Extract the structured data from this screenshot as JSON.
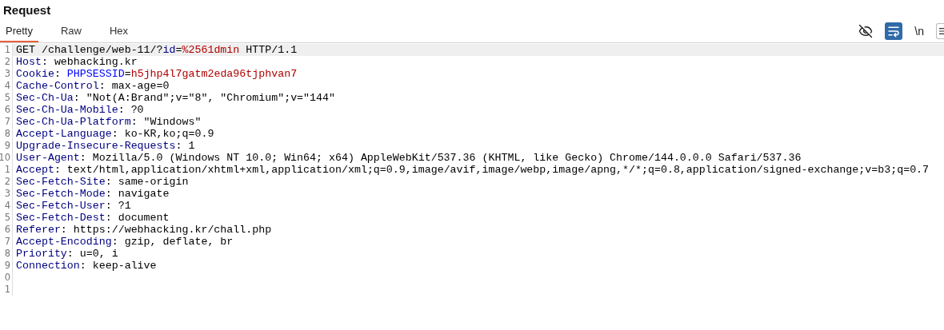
{
  "panel": {
    "title": "Request"
  },
  "tabs": [
    {
      "label": "Pretty",
      "selected": true
    },
    {
      "label": "Raw",
      "selected": false
    },
    {
      "label": "Hex",
      "selected": false
    }
  ],
  "toolbar": {
    "hide_toggle": {
      "on": false
    },
    "wrap_toggle": {
      "on": true
    },
    "newline_toggle": {
      "label": "\\n",
      "on": false
    }
  },
  "editor": {
    "lines": [
      {
        "number": "1",
        "current": true,
        "segments": [
          {
            "kind": "plain",
            "text": "GET /challenge/web-11/?"
          },
          {
            "kind": "name",
            "text": "id"
          },
          {
            "kind": "plain",
            "text": "="
          },
          {
            "kind": "value",
            "text": "%2561dmin"
          },
          {
            "kind": "plain",
            "text": " HTTP/1.1"
          }
        ]
      },
      {
        "number": "2",
        "current": false,
        "segments": [
          {
            "kind": "name",
            "text": "Host"
          },
          {
            "kind": "plain",
            "text": ": webhacking.kr"
          }
        ]
      },
      {
        "number": "3",
        "current": false,
        "segments": [
          {
            "kind": "name",
            "text": "Cookie"
          },
          {
            "kind": "plain",
            "text": ": "
          },
          {
            "kind": "param",
            "text": "PHPSESSID"
          },
          {
            "kind": "plain",
            "text": "="
          },
          {
            "kind": "value",
            "text": "h5jhp4l7gatm2eda96tjphvan7"
          }
        ]
      },
      {
        "number": "4",
        "current": false,
        "segments": [
          {
            "kind": "name",
            "text": "Cache-Control"
          },
          {
            "kind": "plain",
            "text": ": max-age=0"
          }
        ]
      },
      {
        "number": "5",
        "current": false,
        "segments": [
          {
            "kind": "name",
            "text": "Sec-Ch-Ua"
          },
          {
            "kind": "plain",
            "text": ": \"Not(A:Brand\";v=\"8\", \"Chromium\";v=\"144\""
          }
        ]
      },
      {
        "number": "6",
        "current": false,
        "segments": [
          {
            "kind": "name",
            "text": "Sec-Ch-Ua-Mobile"
          },
          {
            "kind": "plain",
            "text": ": ?0"
          }
        ]
      },
      {
        "number": "7",
        "current": false,
        "segments": [
          {
            "kind": "name",
            "text": "Sec-Ch-Ua-Platform"
          },
          {
            "kind": "plain",
            "text": ": \"Windows\""
          }
        ]
      },
      {
        "number": "8",
        "current": false,
        "segments": [
          {
            "kind": "name",
            "text": "Accept-Language"
          },
          {
            "kind": "plain",
            "text": ": ko-KR,ko;q=0.9"
          }
        ]
      },
      {
        "number": "9",
        "current": false,
        "segments": [
          {
            "kind": "name",
            "text": "Upgrade-Insecure-Requests"
          },
          {
            "kind": "plain",
            "text": ": 1"
          }
        ]
      },
      {
        "number": "10",
        "current": false,
        "segments": [
          {
            "kind": "name",
            "text": "User-Agent"
          },
          {
            "kind": "plain",
            "text": ": Mozilla/5.0 (Windows NT 10.0; Win64; x64) AppleWebKit/537.36 (KHTML, like Gecko) Chrome/144.0.0.0 Safari/537.36"
          }
        ]
      },
      {
        "number": "1",
        "current": false,
        "segments": [
          {
            "kind": "name",
            "text": "Accept"
          },
          {
            "kind": "plain",
            "text": ": text/html,application/xhtml+xml,application/xml;q=0.9,image/avif,image/webp,image/apng,*/*;q=0.8,application/signed-exchange;v=b3;q=0.7"
          }
        ]
      },
      {
        "number": "2",
        "current": false,
        "segments": [
          {
            "kind": "name",
            "text": "Sec-Fetch-Site"
          },
          {
            "kind": "plain",
            "text": ": same-origin"
          }
        ]
      },
      {
        "number": "3",
        "current": false,
        "segments": [
          {
            "kind": "name",
            "text": "Sec-Fetch-Mode"
          },
          {
            "kind": "plain",
            "text": ": navigate"
          }
        ]
      },
      {
        "number": "4",
        "current": false,
        "segments": [
          {
            "kind": "name",
            "text": "Sec-Fetch-User"
          },
          {
            "kind": "plain",
            "text": ": ?1"
          }
        ]
      },
      {
        "number": "5",
        "current": false,
        "segments": [
          {
            "kind": "name",
            "text": "Sec-Fetch-Dest"
          },
          {
            "kind": "plain",
            "text": ": document"
          }
        ]
      },
      {
        "number": "6",
        "current": false,
        "segments": [
          {
            "kind": "name",
            "text": "Referer"
          },
          {
            "kind": "plain",
            "text": ": https://webhacking.kr/chall.php"
          }
        ]
      },
      {
        "number": "7",
        "current": false,
        "segments": [
          {
            "kind": "name",
            "text": "Accept-Encoding"
          },
          {
            "kind": "plain",
            "text": ": gzip, deflate, br"
          }
        ]
      },
      {
        "number": "8",
        "current": false,
        "segments": [
          {
            "kind": "name",
            "text": "Priority"
          },
          {
            "kind": "plain",
            "text": ": u=0, i"
          }
        ]
      },
      {
        "number": "9",
        "current": false,
        "segments": [
          {
            "kind": "name",
            "text": "Connection"
          },
          {
            "kind": "plain",
            "text": ": keep-alive"
          }
        ]
      },
      {
        "number": "0",
        "current": false
      },
      {
        "number": "1",
        "current": false
      }
    ]
  }
}
